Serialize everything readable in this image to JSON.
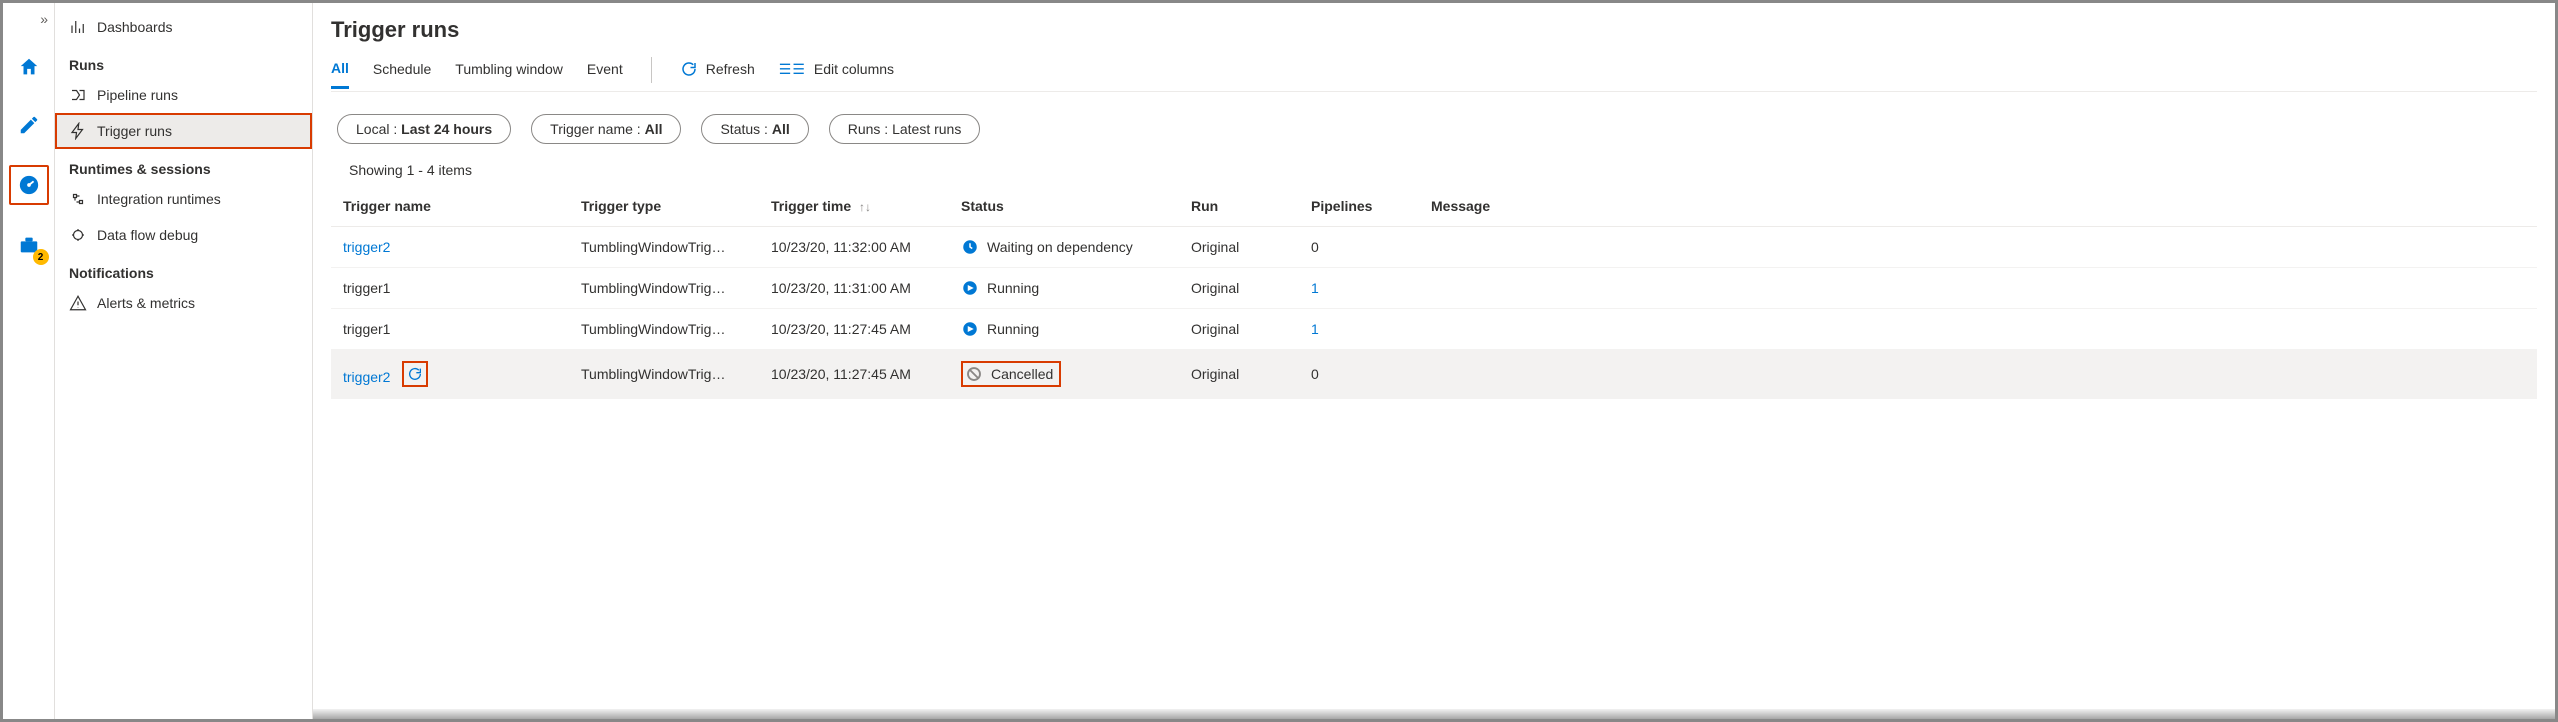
{
  "railBadge": "2",
  "sidebar": {
    "dashboards": "Dashboards",
    "runsHeader": "Runs",
    "pipelineRuns": "Pipeline runs",
    "triggerRuns": "Trigger runs",
    "runtimesHeader": "Runtimes & sessions",
    "integrationRuntimes": "Integration runtimes",
    "dataFlowDebug": "Data flow debug",
    "notificationsHeader": "Notifications",
    "alertsMetrics": "Alerts & metrics"
  },
  "page": {
    "title": "Trigger runs",
    "tabs": {
      "all": "All",
      "schedule": "Schedule",
      "tumbling": "Tumbling window",
      "event": "Event"
    },
    "actions": {
      "refresh": "Refresh",
      "editColumns": "Edit columns"
    },
    "filters": {
      "local": {
        "label": "Local : ",
        "value": "Last 24 hours"
      },
      "triggerName": {
        "label": "Trigger name : ",
        "value": "All"
      },
      "status": {
        "label": "Status : ",
        "value": "All"
      },
      "runs": {
        "label": "Runs : ",
        "value": "Latest runs"
      }
    },
    "showing": "Showing 1 - 4 items",
    "columns": {
      "triggerName": "Trigger name",
      "triggerType": "Trigger type",
      "triggerTime": "Trigger time",
      "status": "Status",
      "run": "Run",
      "pipelines": "Pipelines",
      "message": "Message"
    },
    "rows": [
      {
        "name": "trigger2",
        "nameLink": true,
        "type": "TumblingWindowTrig…",
        "time": "10/23/20, 11:32:00 AM",
        "statusIcon": "clock",
        "status": "Waiting on dependency",
        "run": "Original",
        "pipelines": "0",
        "pipelinesLink": false
      },
      {
        "name": "trigger1",
        "nameLink": false,
        "type": "TumblingWindowTrig…",
        "time": "10/23/20, 11:31:00 AM",
        "statusIcon": "running",
        "status": "Running",
        "run": "Original",
        "pipelines": "1",
        "pipelinesLink": true
      },
      {
        "name": "trigger1",
        "nameLink": false,
        "type": "TumblingWindowTrig…",
        "time": "10/23/20, 11:27:45 AM",
        "statusIcon": "running",
        "status": "Running",
        "run": "Original",
        "pipelines": "1",
        "pipelinesLink": true
      },
      {
        "name": "trigger2",
        "nameLink": true,
        "type": "TumblingWindowTrig…",
        "time": "10/23/20, 11:27:45 AM",
        "statusIcon": "cancel",
        "status": "Cancelled",
        "run": "Original",
        "pipelines": "0",
        "pipelinesLink": false,
        "hovered": true,
        "showRerun": true,
        "boxStatus": true
      }
    ]
  }
}
